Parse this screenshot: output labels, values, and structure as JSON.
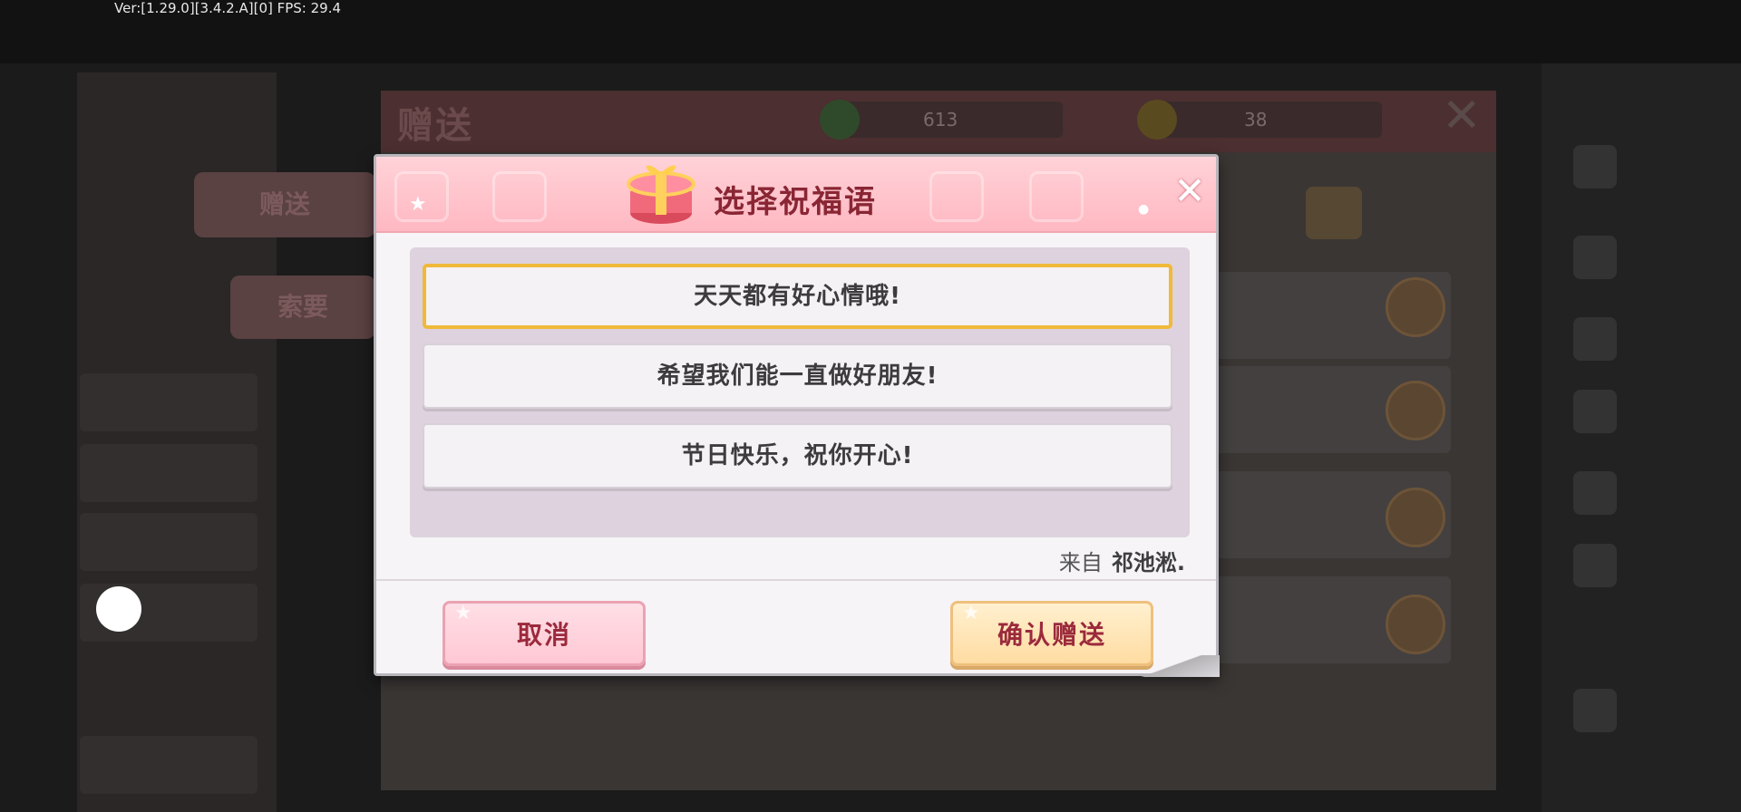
{
  "debug": {
    "version_text": "Ver:[1.29.0][3.4.2.A][0] FPS: 29.4"
  },
  "background_window": {
    "title": "赠送",
    "currency": [
      {
        "icon": "green-gem-icon",
        "value": "613"
      },
      {
        "icon": "gold-coin-icon",
        "value": "38"
      }
    ],
    "tabs": [
      "赠送",
      "索要"
    ]
  },
  "dialog": {
    "title": "选择祝福语",
    "close_icon": "close-icon",
    "options": [
      {
        "label": "天天都有好心情哦!",
        "selected": true
      },
      {
        "label": "希望我们能一直做好朋友!",
        "selected": false
      },
      {
        "label": "节日快乐，祝你开心!",
        "selected": false
      }
    ],
    "from_label": "来自",
    "from_name": "祁池淞.",
    "cancel_label": "取消",
    "confirm_label": "确认赠送"
  },
  "colors": {
    "header_pink": "#ffb8c2",
    "title_red": "#8a2634",
    "selected_border": "#f0b93a"
  }
}
